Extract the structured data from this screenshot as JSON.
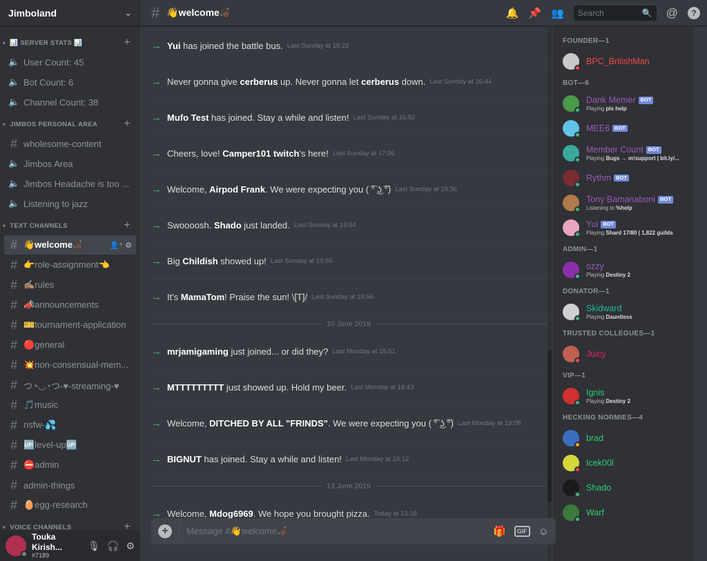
{
  "server": {
    "name": "Jimboland"
  },
  "categories": {
    "stats": "SERVER STATS",
    "stats_emoji": "📊",
    "personal": "JIMBOS PERSONAL AREA",
    "text": "TEXT CHANNELS",
    "voice": "VOICE CHANNELS"
  },
  "stat_channels": [
    "User Count: 45",
    "Bot Count: 6",
    "Channel Count: 38"
  ],
  "personal_channels": [
    {
      "name": "wholesome-content",
      "type": "text"
    },
    {
      "name": "Jimbos Area",
      "type": "voice"
    },
    {
      "name": "Jimbos Headache is too ...",
      "type": "voice"
    },
    {
      "name": "Listening to jazz",
      "type": "voice"
    }
  ],
  "text_channels": [
    "👋welcome👋🏿",
    "👉role-assignment👈",
    "✍🏽rules",
    "📣announcements",
    "🎫tournament-application",
    "🔴general",
    "💥non-consensual-mem...",
    "つ◔◡◔つ-♥-streaming-♥",
    "🎵music",
    "nsfw-💦",
    "🆙level-up🆙",
    "⛔admin",
    "admin-things",
    "🥚egg-research"
  ],
  "user": {
    "name": "Touka Kirish...",
    "tag": "#7189"
  },
  "channel": {
    "title": "👋welcome👋🏿"
  },
  "search": {
    "placeholder": "Search"
  },
  "messages": [
    {
      "pre": "",
      "bold": "Yui",
      "post": " has joined the battle bus.",
      "ts": "Last Sunday at 16:22"
    },
    {
      "pre": "Never gonna give ",
      "bold": "cerberus",
      "post": " up. Never gonna let ",
      "bold2": "cerberus",
      "post2": " down.",
      "ts": "Last Sunday at 16:44"
    },
    {
      "pre": "",
      "bold": "Mufo Test",
      "post": " has joined. Stay a while and listen!",
      "ts": "Last Sunday at 16:52"
    },
    {
      "pre": "Cheers, love! ",
      "bold": "Camper101 twitch",
      "post": "'s here!",
      "ts": "Last Sunday at 17:36"
    },
    {
      "pre": "Welcome, ",
      "bold": "Airpod Frank",
      "post": ". We were expecting you ( ͡° ͜ʖ ͡°)",
      "ts": "Last Sunday at 19:36"
    },
    {
      "pre": "Swoooosh. ",
      "bold": "Shado",
      "post": " just landed.",
      "ts": "Last Sunday at 19:54"
    },
    {
      "pre": "Big ",
      "bold": "Childish",
      "post": " showed up!",
      "ts": "Last Sunday at 19:55"
    },
    {
      "pre": "It's ",
      "bold": "MamaTom",
      "post": "! Praise the sun! \\[T]/",
      "ts": "Last Sunday at 19:56"
    },
    {
      "pre": "",
      "bold": "mrjamigaming",
      "post": " just joined... or did they?",
      "ts": "Last Monday at 15:51"
    },
    {
      "pre": "",
      "bold": "MTTTTTTTTT",
      "post": " just showed up. Hold my beer.",
      "ts": "Last Monday at 16:43"
    },
    {
      "pre": "Welcome, ",
      "bold": "DITCHED BY ALL \"FRINDS\"",
      "post": ". We were expecting you ( ͡° ͜ʖ ͡°)",
      "ts": "Last Monday at 19:08"
    },
    {
      "pre": "",
      "bold": "BIGNUT",
      "post": " has joined. Stay a while and listen!",
      "ts": "Last Monday at 19:12"
    },
    {
      "pre": "Welcome, ",
      "bold": "Mdog6969",
      "post": ". We hope you brought pizza.",
      "ts": "Today at 13:16"
    }
  ],
  "dividers": [
    "10 June 2019",
    "13 June 2019"
  ],
  "composer": {
    "placeholder": "Message #👋welcome👋🏿",
    "gif": "GIF"
  },
  "member_groups": [
    {
      "label": "FOUNDER—1",
      "members": [
        {
          "name": "BPC_BritishMan",
          "color": "#f04747",
          "status": "#f04747",
          "av": "#c9c9c9"
        }
      ]
    },
    {
      "label": "BOT—6",
      "members": [
        {
          "name": "Dank Memer",
          "color": "#9b59b6",
          "bot": "BOT",
          "activity": "Playing",
          "act_bold": "pls help",
          "status": "#43b581",
          "av": "#4a9b4a"
        },
        {
          "name": "MEE6",
          "color": "#9b59b6",
          "bot": "BOT",
          "status": "#43b581",
          "av": "#5ec4e8"
        },
        {
          "name": "Member Count",
          "color": "#9b59b6",
          "bot": "BOT",
          "activity": "Playing",
          "act_bold": "Bugs → m!support | bit.ly/...",
          "status": "#43b581",
          "av": "#3aa89a"
        },
        {
          "name": "Rythm",
          "color": "#9b59b6",
          "bot": "BOT",
          "status": "#43b581",
          "av": "#7a2c33"
        },
        {
          "name": "Tony Bamanaboni",
          "color": "#9b59b6",
          "bot": "BOT",
          "activity": "Listening to",
          "act_bold": "%help",
          "status": "#43b581",
          "av": "#b07a4a"
        },
        {
          "name": "Yui",
          "color": "#9b59b6",
          "bot": "BOT",
          "activity": "Playing",
          "act_bold": "Shard 17/80 | 1,822 guilds",
          "status": "#43b581",
          "av": "#e8a5c0"
        }
      ]
    },
    {
      "label": "ADMIN—1",
      "members": [
        {
          "name": "ozzy",
          "color": "#9b59b6",
          "activity": "Playing",
          "act_bold": "Destiny 2",
          "status": "#43b581",
          "av": "#8b2fa8"
        }
      ]
    },
    {
      "label": "DONATOR—1",
      "members": [
        {
          "name": "Skidward",
          "color": "#1abc9c",
          "activity": "Playing",
          "act_bold": "Dauntless",
          "status": "#43b581",
          "av": "#cfcfcf"
        }
      ]
    },
    {
      "label": "TRUSTED COLLEGUES—1",
      "members": [
        {
          "name": "Juicy",
          "color": "#e91e63",
          "status": "#f04747",
          "av": "#c06050"
        }
      ]
    },
    {
      "label": "VIP—1",
      "members": [
        {
          "name": "Ignis",
          "color": "#2ecc71",
          "activity": "Playing",
          "act_bold": "Destiny 2",
          "status": "#43b581",
          "av": "#d03030"
        }
      ]
    },
    {
      "label": "HECKING NORMIES—4",
      "members": [
        {
          "name": "brad",
          "color": "#2ecc71",
          "status": "#faa61a",
          "av": "#3a6fc0"
        },
        {
          "name": "Icek00l",
          "color": "#2ecc71",
          "status": "#f04747",
          "av": "#d6d63a"
        },
        {
          "name": "Shado",
          "color": "#2ecc71",
          "status": "#43b581",
          "av": "#1a1a1a"
        },
        {
          "name": "Warf",
          "color": "#2ecc71",
          "status": "#43b581",
          "av": "#3a7a3a"
        }
      ]
    }
  ]
}
